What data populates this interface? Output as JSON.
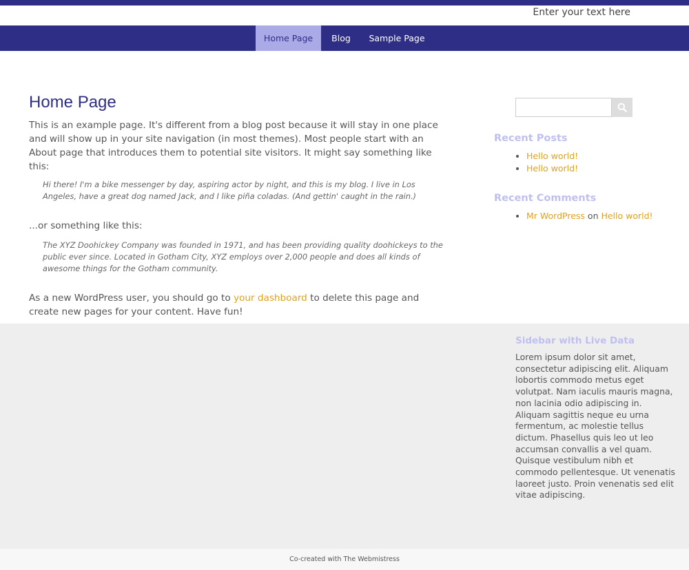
{
  "header": {
    "tagline": "Enter your text here"
  },
  "nav": {
    "items": [
      {
        "label": "Home Page"
      },
      {
        "label": "Blog"
      },
      {
        "label": "Sample Page"
      }
    ]
  },
  "main": {
    "title": "Home Page",
    "intro": "This is an example page. It's different from a blog post because it will stay in one place and will show up in your site navigation (in most themes). Most people start with an About page that introduces them to potential site visitors. It might say something like this:",
    "quote1": "Hi there! I'm a bike messenger by day, aspiring actor by night, and this is my blog. I live in Los Angeles, have a great dog named Jack, and I like piña coladas. (And gettin' caught in the rain.)",
    "or_text": "...or something like this:",
    "quote2": "The XYZ Doohickey Company was founded in 1971, and has been providing quality doohickeys to the public ever since. Located in Gotham City, XYZ employs over 2,000 people and does all kinds of awesome things for the Gotham community.",
    "outro_before": "As a new WordPress user, you should go to ",
    "outro_link": "your dashboard",
    "outro_after": " to delete this page and create new pages for your content. Have fun!"
  },
  "sidebar": {
    "search": {
      "placeholder": ""
    },
    "recent_posts": {
      "title": "Recent Posts",
      "items": [
        "Hello world!",
        "Hello world!"
      ]
    },
    "recent_comments": {
      "title": "Recent Comments",
      "author": "Mr WordPress",
      "on": "on",
      "post": "Hello world!"
    },
    "live": {
      "title": "Sidebar with Live Data",
      "text": "Lorem ipsum dolor sit amet, consectetur adipiscing elit. Aliquam lobortis commodo metus eget volutpat. Nam iaculis mauris magna, non lacinia odio adipiscing in. Aliquam sagittis neque eu urna fermentum, ac molestie tellus dictum. Phasellus quis leo ut leo accumsan convallis a vel quam. Quisque vestibulum nibh et commodo pellentesque. Ut venenatis laoreet justo. Proin venenatis sed elit vitae adipiscing."
    }
  },
  "footer": {
    "text": "Co-created with The Webmistress"
  },
  "colors": {
    "nav_bg": "#2e2e86",
    "nav_active_bg": "#a9aae6",
    "link": "#e0a020",
    "widget_title": "#bfc0ee",
    "lower_bg": "#eeeeee"
  }
}
